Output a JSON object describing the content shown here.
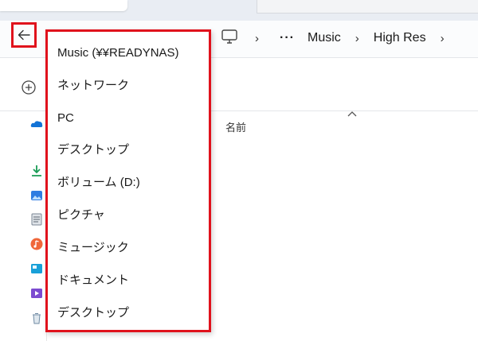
{
  "window": {
    "back_tooltip": "",
    "accent": "#e0121c"
  },
  "breadcrumb": {
    "overflow_label": "···",
    "items": [
      "Music",
      "High Res"
    ]
  },
  "content": {
    "name_column_header": "名前"
  },
  "recent_locations": [
    "Music (¥¥READYNAS)",
    "ネットワーク",
    "PC",
    "デスクトップ",
    "ボリューム (D:)",
    "ピクチャ",
    "ミュージック",
    "ドキュメント",
    "デスクトップ"
  ],
  "icons": {
    "back": "arrow-left-icon",
    "pc": "pc-monitor-icon",
    "new": "plus-circle-icon",
    "nav": [
      "onedrive-icon",
      "downloads-icon",
      "pictures-icon",
      "documents-icon",
      "music-icon",
      "gallery-icon",
      "videos-icon",
      "recycle-icon"
    ]
  }
}
